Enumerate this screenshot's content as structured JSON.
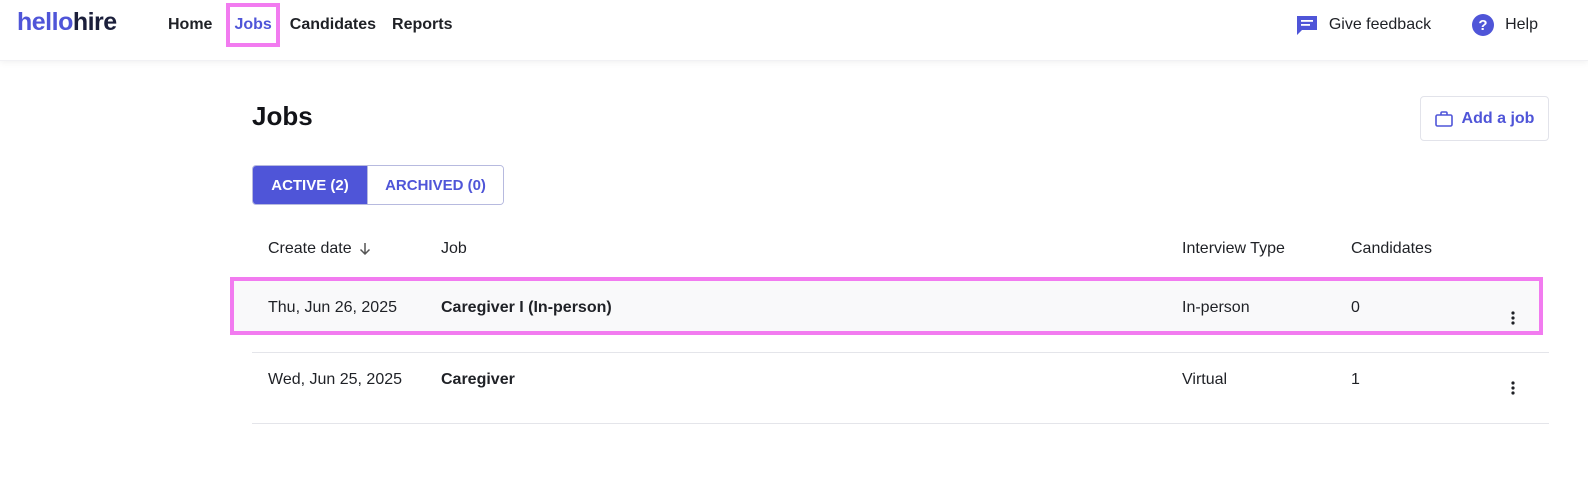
{
  "logo": {
    "hello": "hello",
    "hire": "hire"
  },
  "nav": {
    "home": "Home",
    "jobs": "Jobs",
    "candidates": "Candidates",
    "reports": "Reports"
  },
  "top_right": {
    "feedback": "Give feedback",
    "help": "Help"
  },
  "page": {
    "title": "Jobs",
    "add_job": "Add a job"
  },
  "tabs": {
    "active": "ACTIVE (2)",
    "archived": "ARCHIVED (0)"
  },
  "table": {
    "headers": {
      "create_date": "Create date",
      "job": "Job",
      "interview_type": "Interview Type",
      "candidates": "Candidates"
    },
    "rows": [
      {
        "date": "Thu, Jun 26, 2025",
        "job": "Caregiver I (In-person)",
        "interview_type": "In-person",
        "candidates": "0"
      },
      {
        "date": "Wed, Jun 25, 2025",
        "job": "Caregiver",
        "interview_type": "Virtual",
        "candidates": "1"
      }
    ]
  },
  "colors": {
    "accent": "#4f55d8",
    "highlight": "#f27bf0",
    "logo_dark": "#1b1f3b"
  }
}
